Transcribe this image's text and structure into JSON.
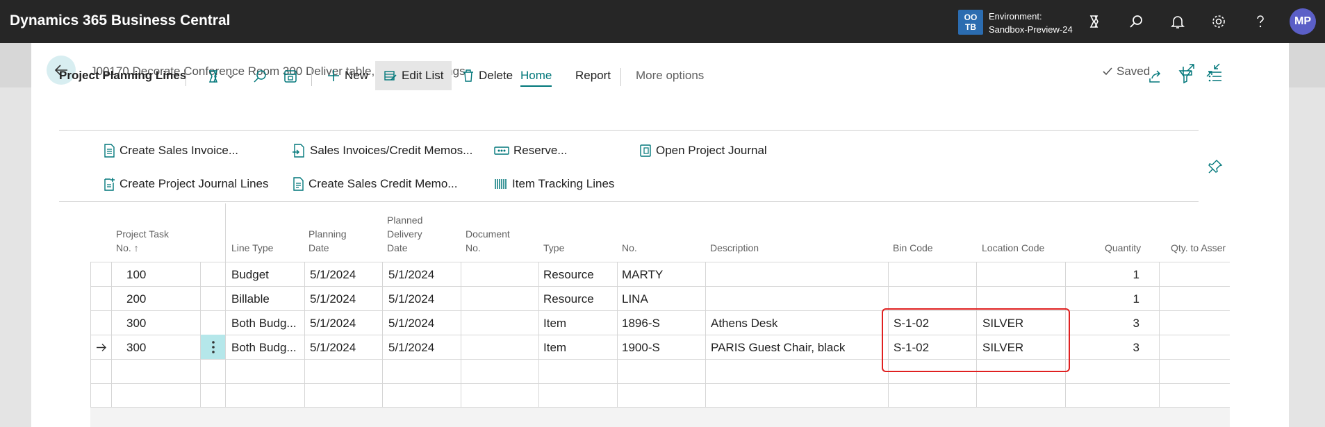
{
  "app": {
    "title": "Dynamics 365 Business Central",
    "env_badge": "OO\nTB",
    "env_label": "Environment:",
    "env_name": "Sandbox-Preview-24",
    "avatar": "MP"
  },
  "dialog": {
    "title": "J00170 Decorate Conference Room 300 Deliver table, other furnishings",
    "saved": "Saved"
  },
  "actionbar": {
    "title": "Project Planning Lines",
    "new": "New",
    "edit_list": "Edit List",
    "delete": "Delete",
    "home": "Home",
    "report": "Report",
    "more": "More options"
  },
  "ribbon": {
    "create_sales_invoice": "Create Sales Invoice...",
    "sales_invoices_credit_memos": "Sales Invoices/Credit Memos...",
    "reserve": "Reserve...",
    "open_project_journal": "Open Project Journal",
    "create_project_journal_lines": "Create Project Journal Lines",
    "create_sales_credit_memo": "Create Sales Credit Memo...",
    "item_tracking_lines": "Item Tracking Lines"
  },
  "table": {
    "headers": {
      "task_no_1": "Project Task",
      "task_no_2": "No. ↑",
      "line_type": "Line Type",
      "planning_1": "Planning",
      "planning_2": "Date",
      "delivery_1": "Planned",
      "delivery_2": "Delivery",
      "delivery_3": "Date",
      "document_1": "Document",
      "document_2": "No.",
      "type": "Type",
      "no": "No.",
      "description": "Description",
      "bin_code": "Bin Code",
      "location_code": "Location Code",
      "quantity": "Quantity",
      "qty_assemble": "Qty. to Asser"
    },
    "rows": [
      {
        "task": "100",
        "line_type": "Budget",
        "planning": "5/1/2024",
        "delivery": "5/1/2024",
        "document": "",
        "type": "Resource",
        "no": "MARTY",
        "description": "",
        "bin": "",
        "location": "",
        "quantity": "1"
      },
      {
        "task": "200",
        "line_type": "Billable",
        "planning": "5/1/2024",
        "delivery": "5/1/2024",
        "document": "",
        "type": "Resource",
        "no": "LINA",
        "description": "",
        "bin": "",
        "location": "",
        "quantity": "1"
      },
      {
        "task": "300",
        "line_type": "Both Budg...",
        "planning": "5/1/2024",
        "delivery": "5/1/2024",
        "document": "",
        "type": "Item",
        "no": "1896-S",
        "description": "Athens Desk",
        "bin": "S-1-02",
        "location": "SILVER",
        "quantity": "3"
      },
      {
        "task": "300",
        "line_type": "Both Budg...",
        "planning": "5/1/2024",
        "delivery": "5/1/2024",
        "document": "",
        "type": "Item",
        "no": "1900-S",
        "description": "PARIS Guest Chair, black",
        "bin": "S-1-02",
        "location": "SILVER",
        "quantity": "3"
      }
    ]
  },
  "colors": {
    "topbar": "#262626",
    "accent": "#00777a",
    "avatar": "#5b5fc7",
    "highlight": "#e02020"
  }
}
